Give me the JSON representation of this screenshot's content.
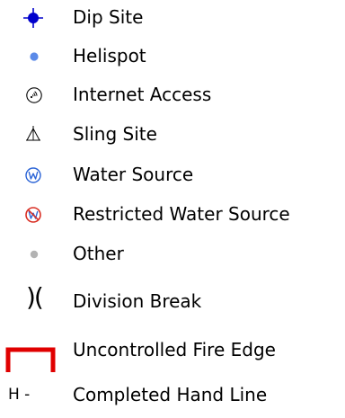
{
  "legend": {
    "items": [
      {
        "label": "Dip Site",
        "icon": "dip-site-icon",
        "color": "#0000cc"
      },
      {
        "label": "Helispot",
        "icon": "helispot-icon",
        "color": "#5b8ae8"
      },
      {
        "label": "Internet Access",
        "icon": "internet-access-icon",
        "color": "#000000"
      },
      {
        "label": "Sling Site",
        "icon": "sling-site-icon",
        "color": "#000000"
      },
      {
        "label": "Water Source",
        "icon": "water-source-icon",
        "color": "#2a63d6"
      },
      {
        "label": "Restricted Water Source",
        "icon": "restricted-water-source-icon",
        "color": "#2a63d6",
        "restriction_color": "#d93025"
      },
      {
        "label": "Other",
        "icon": "other-icon",
        "color": "#b3b3b3"
      },
      {
        "label": "Division Break",
        "icon": "division-break-icon",
        "color": "#000000",
        "glyph": ")("
      },
      {
        "label": "Uncontrolled Fire Edge",
        "icon": "uncontrolled-fire-edge-icon",
        "color": "#e00000"
      },
      {
        "label": "Completed Hand Line",
        "icon": "completed-hand-line-icon",
        "color": "#000000",
        "glyph": "H -"
      }
    ]
  }
}
